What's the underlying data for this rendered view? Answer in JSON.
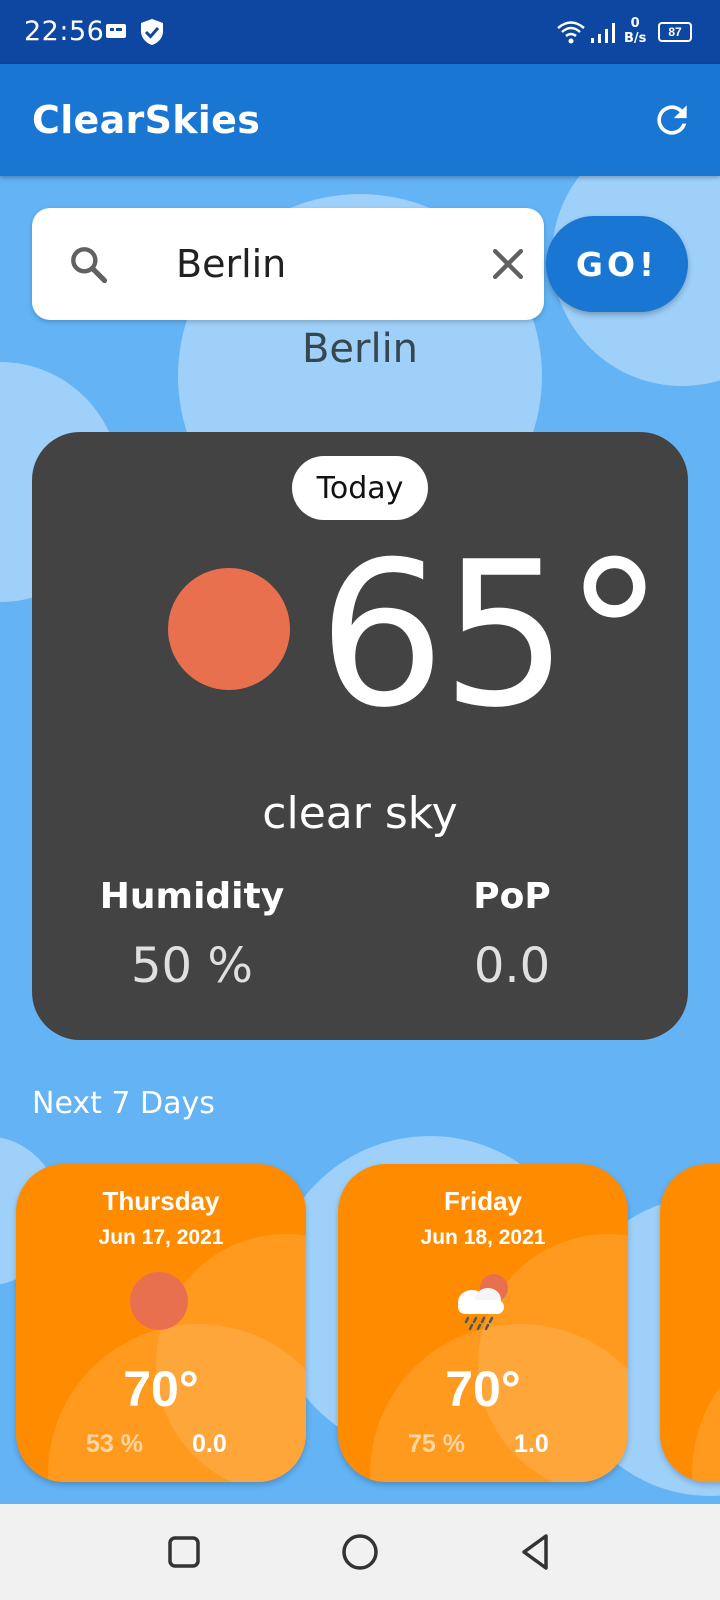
{
  "status_bar": {
    "time": "22:56",
    "network_speed_value": "0",
    "network_speed_unit": "B/s",
    "battery": "87",
    "icons": [
      "message-icon",
      "shield-icon",
      "wifi-icon",
      "signal-icon",
      "battery-icon"
    ]
  },
  "app_bar": {
    "title": "ClearSkies",
    "refresh_icon": "refresh-icon"
  },
  "search": {
    "value": "Berlin",
    "placeholder": "",
    "search_icon": "search-icon",
    "clear_icon": "close-icon",
    "go_label": "GO!"
  },
  "city": "Berlin",
  "today": {
    "chip": "Today",
    "temperature": "65°",
    "description": "clear sky",
    "humidity_label": "Humidity",
    "humidity_value": "50 %",
    "pop_label": "PoP",
    "pop_value": "0.0",
    "icon": "sun-icon"
  },
  "forecast": {
    "title": "Next 7 Days",
    "days": [
      {
        "day": "Thursday",
        "date": "Jun 17, 2021",
        "temperature": "70°",
        "humidity": "53 %",
        "pop": "0.0",
        "icon": "sun-icon"
      },
      {
        "day": "Friday",
        "date": "Jun 18, 2021",
        "temperature": "70°",
        "humidity": "75 %",
        "pop": "1.0",
        "icon": "rain-cloud-sun-icon"
      }
    ]
  },
  "colors": {
    "status_bar": "#0d47a1",
    "app_bar": "#1976d2",
    "background": "#63b3f5",
    "today_card": "#434343",
    "sun": "#e8704e",
    "forecast_card": "#ff8c00"
  },
  "nav_bar": {
    "icons": [
      "recent-apps-icon",
      "home-icon",
      "back-icon"
    ]
  }
}
